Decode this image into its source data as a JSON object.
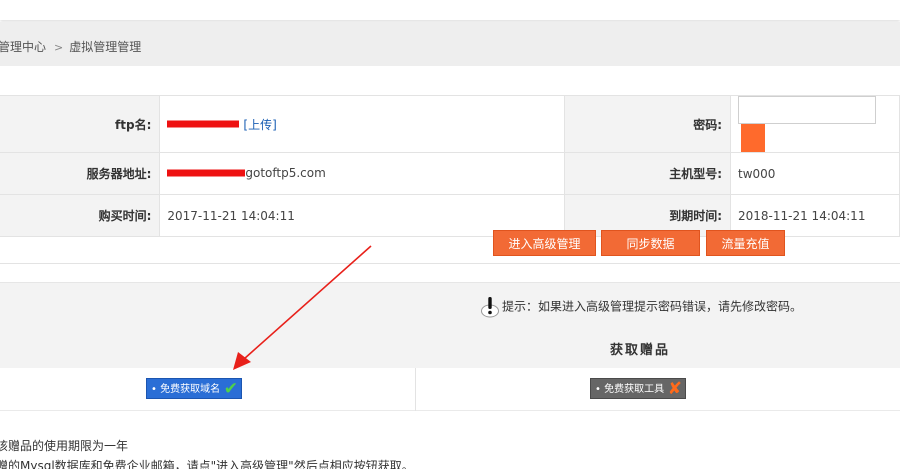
{
  "breadcrumb": {
    "root": "管理中心",
    "current": "虚拟管理管理"
  },
  "info": {
    "ftp_name_label": "ftp名:",
    "upload_link": "[上传]",
    "password_label": "密码:",
    "password_placeholder": "",
    "server_label": "服务器地址:",
    "server_suffix": "gotoftp5.com",
    "host_model_label": "主机型号:",
    "host_model_value": "tw000",
    "purchase_label": "购买时间:",
    "purchase_value": "2017-11-21 14:04:11",
    "expire_label": "到期时间:",
    "expire_value": "2018-11-21 14:04:11"
  },
  "actions": {
    "advanced": "进入高级管理",
    "sync": "同步数据",
    "recharge": "流量充值"
  },
  "tip": {
    "text": "提示：如果进入高级管理提示密码错误，请先修改密码。"
  },
  "gifts": {
    "title": "获取赠品",
    "left_label": "• 免费获取域名",
    "right_label": "• 免费获取工具"
  },
  "notes": {
    "line1": "该赠品的使用期限为一年",
    "line2": "赠的Mysql数据库和免费企业邮箱，请点\"进入高级管理\"然后点相应按钮获取。"
  },
  "colors": {
    "accent": "#f26a35",
    "redaction": "#ee1111",
    "annotation_arrow": "#e8201a"
  },
  "icons": {
    "tip": "exclamation-icon",
    "success": "check-icon",
    "fail": "x-icon"
  }
}
